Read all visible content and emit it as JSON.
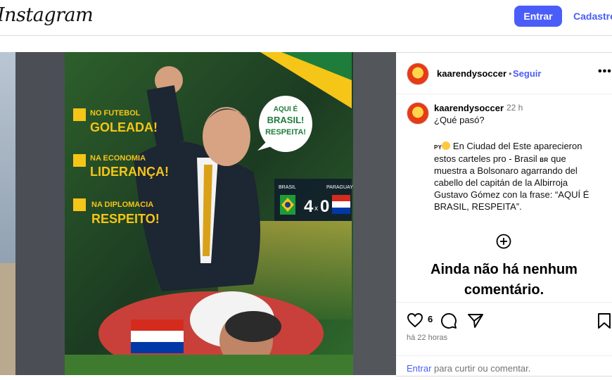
{
  "header": {
    "logo_text": "Instagram",
    "login_label": "Entrar",
    "signup_label": "Cadastre-se"
  },
  "post": {
    "username": "kaarendysoccer",
    "separator": "•",
    "follow_label": "Seguir",
    "more_label": "•••",
    "caption": {
      "username": "kaarendysoccer",
      "time": "22 h",
      "line1": "¿Qué pasó?",
      "country_py": "PY",
      "line2": "En Ciudad del Este aparecieron",
      "line3a": "estos carteles pro - Brasil",
      "country_br": "BR",
      "line3b": "que",
      "line4": "muestra a Bolsonaro agarrando del",
      "line5": "cabello del capitán de la Albirroja",
      "line6": "Gustavo Gómez con la frase: “AQUÍ É",
      "line7": "BRASIL, RESPEITA”."
    },
    "no_comments_line1": "Ainda não há nenhum",
    "no_comments_line2": "comentário.",
    "likes": "6",
    "time_ago": "há 22 horas",
    "login_link": "Entrar",
    "login_text": "para curtir ou comentar."
  },
  "billboard": {
    "items": [
      {
        "small": "NO FUTEBOL",
        "big": "GOLEADA!"
      },
      {
        "small": "NA ECONOMIA",
        "big": "LIDERANÇA!"
      },
      {
        "small": "NA DIPLOMACIA",
        "big": "RESPEITO!"
      }
    ],
    "speech": [
      "AQUI É",
      "BRASIL!",
      "RESPEITA!"
    ],
    "score": {
      "home": "BRASIL",
      "away": "PARAGUAY",
      "home_goals": "4",
      "sep": "x",
      "away_goals": "0"
    }
  },
  "colors": {
    "accent": "#4a5df9",
    "secondary_text": "#737373",
    "divider": "#dbdbdb",
    "billboard_yellow": "#f5c518",
    "billboard_green": "#1e7d3a"
  }
}
